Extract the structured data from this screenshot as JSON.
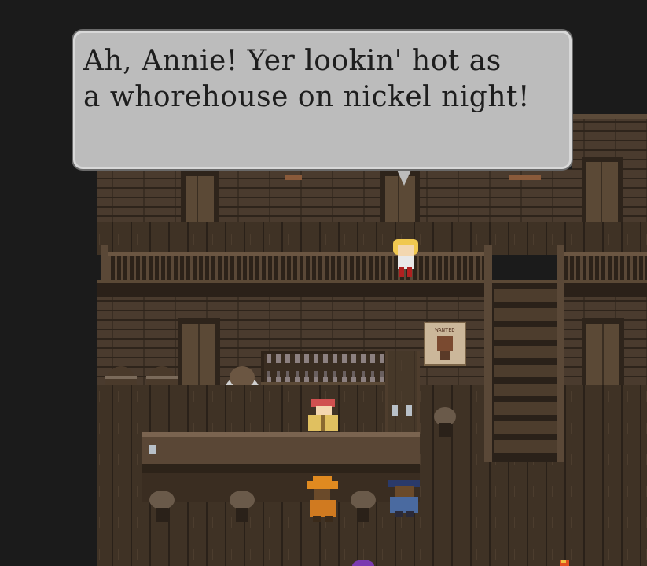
{
  "dialog": {
    "lines": [
      "Ah, Annie! Yer lookin' hot as",
      "a whorehouse on nickel night!"
    ]
  },
  "scene": {
    "poster_text": "WANTED",
    "colors": {
      "background": "#1b1b1b",
      "wall": "#4a3b2e",
      "floor": "#3d3023",
      "dialog_box": "#bcbcbc",
      "dialog_text": "#1e1e1e"
    }
  }
}
